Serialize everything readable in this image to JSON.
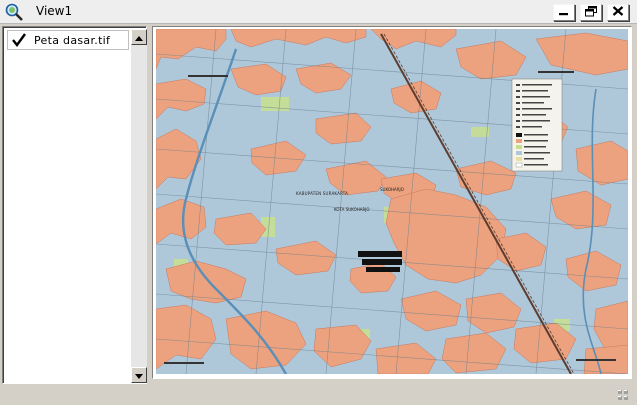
{
  "window": {
    "title": "View1"
  },
  "titlebar_buttons": {
    "minimize": "minimize",
    "restore": "restore",
    "close": "close"
  },
  "toc": {
    "layers": [
      {
        "name": "Peta dasar.tif",
        "checked": true
      }
    ]
  },
  "map": {
    "layer_name": "Peta dasar.tif",
    "labels": [
      "KABUPATEN SURAKARTA",
      "KOTA SUKOHARJO",
      "SUKOHARJO"
    ],
    "colors": {
      "water_bg": "#aec7d9",
      "settlement": "#eca27e",
      "field": "#c8e08c",
      "road": "#7a5a4a"
    }
  },
  "colors": {
    "window_bg": "#d4d0c8",
    "titlebar_bg": "#eeeeee"
  }
}
